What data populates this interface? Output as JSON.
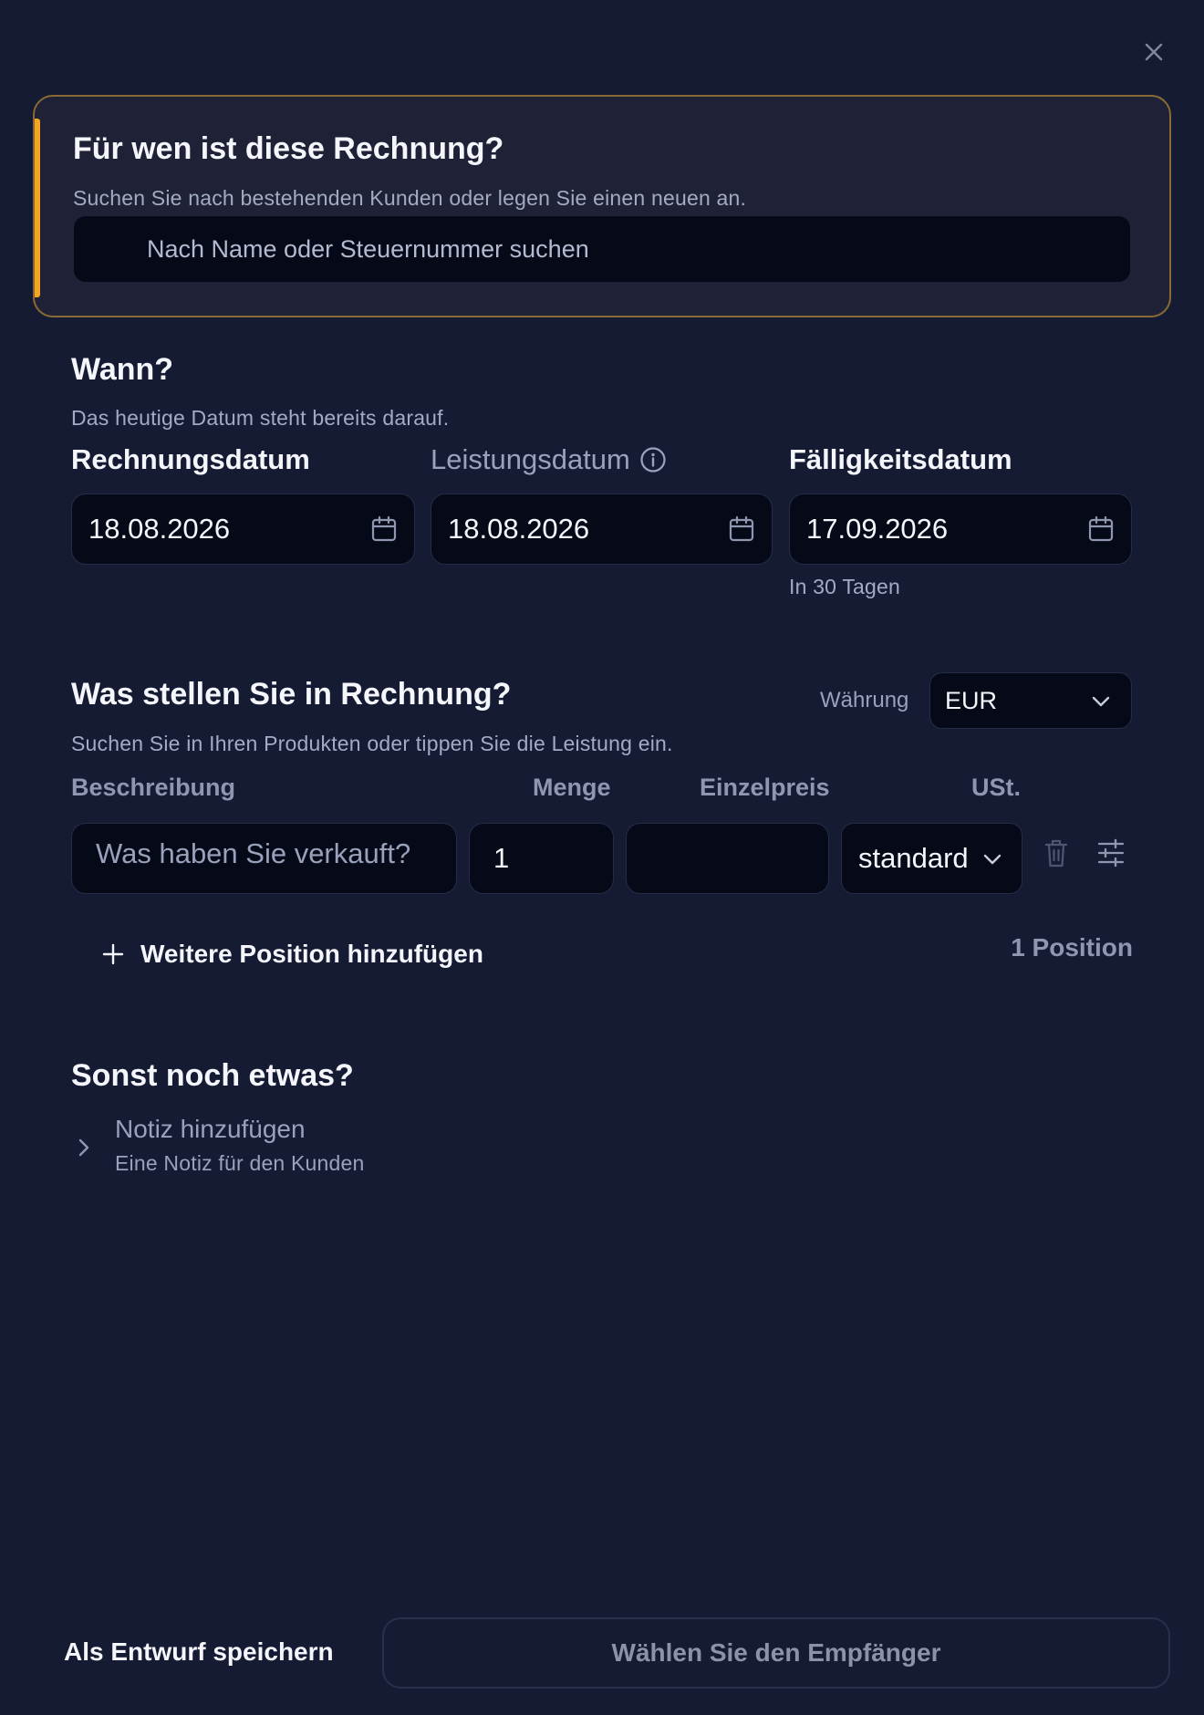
{
  "recipient": {
    "title": "Für wen ist diese Rechnung?",
    "subtitle": "Suchen Sie nach bestehenden Kunden oder legen Sie einen neuen an.",
    "search_placeholder": "Nach Name oder Steuernummer suchen"
  },
  "when": {
    "title": "Wann?",
    "subtitle": "Das heutige Datum steht bereits darauf.",
    "invoice_date_label": "Rechnungsdatum",
    "invoice_date_value": "18.08.2026",
    "service_date_label": "Leistungsdatum",
    "service_date_value": "18.08.2026",
    "due_date_label": "Fälligkeitsdatum",
    "due_date_value": "17.09.2026",
    "due_hint": "In 30 Tagen"
  },
  "items": {
    "title": "Was stellen Sie in Rechnung?",
    "subtitle": "Suchen Sie in Ihren Produkten oder tippen Sie die Leistung ein.",
    "currency_label": "Währung",
    "currency_value": "EUR",
    "columns": {
      "description": "Beschreibung",
      "quantity": "Menge",
      "unit_price": "Einzelpreis",
      "vat": "USt."
    },
    "row": {
      "description_placeholder": "Was haben Sie verkauft?",
      "quantity": "1",
      "unit_price": "",
      "vat": "standard"
    },
    "add_label": "Weitere Position hinzufügen",
    "count_label": "1 Position"
  },
  "other": {
    "title": "Sonst noch etwas?",
    "note_label": "Notiz hinzufügen",
    "note_sub": "Eine Notiz für den Kunden"
  },
  "footer": {
    "save_draft": "Als Entwurf speichern",
    "primary": "Wählen Sie den Empfänger"
  },
  "colors": {
    "background": "#151b33",
    "accent": "#f5a524",
    "input_bg": "#060a18"
  }
}
